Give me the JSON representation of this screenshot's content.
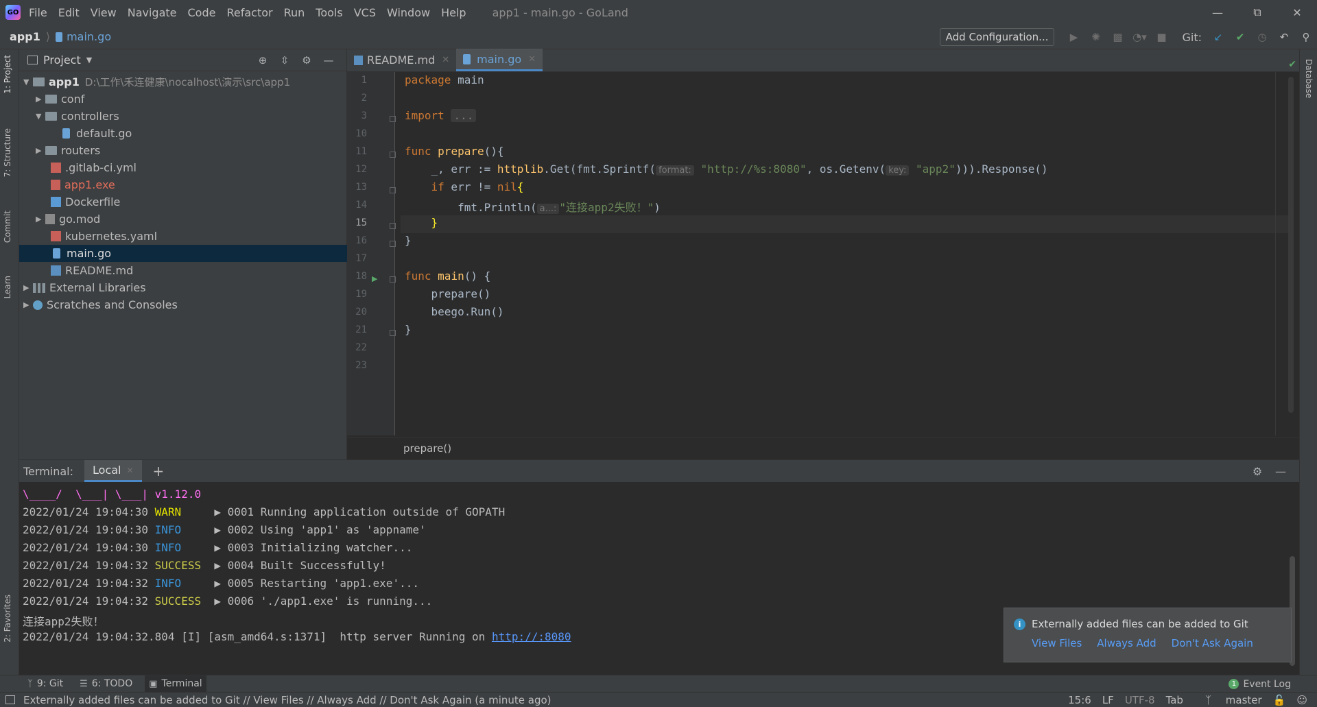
{
  "window": {
    "title": "app1 - main.go - GoLand",
    "menu": [
      "File",
      "Edit",
      "View",
      "Navigate",
      "Code",
      "Refactor",
      "Run",
      "Tools",
      "VCS",
      "Window",
      "Help"
    ],
    "controls": [
      "minimize-icon",
      "restore-icon",
      "close-icon"
    ]
  },
  "navbar": {
    "project": "app1",
    "file": "main.go",
    "add_configuration": "Add Configuration...",
    "git_label": "Git:"
  },
  "left_strip": {
    "project_tab": "1: Project",
    "structure_tab": "7: Structure",
    "commit_tab": "Commit",
    "learn_tab": "Learn",
    "favorites_tab": "2: Favorites"
  },
  "right_strip": {
    "database_tab": "Database"
  },
  "project_panel": {
    "title": "Project",
    "tree": [
      {
        "label": "app1",
        "path": "D:\\工作\\禾连健康\\nocalhost\\演示\\src\\app1"
      },
      {
        "label": "conf"
      },
      {
        "label": "controllers"
      },
      {
        "label": "default.go"
      },
      {
        "label": "routers"
      },
      {
        "label": ".gitlab-ci.yml"
      },
      {
        "label": "app1.exe"
      },
      {
        "label": "Dockerfile"
      },
      {
        "label": "go.mod"
      },
      {
        "label": "kubernetes.yaml"
      },
      {
        "label": "main.go"
      },
      {
        "label": "README.md"
      },
      {
        "label": "External Libraries"
      },
      {
        "label": "Scratches and Consoles"
      }
    ]
  },
  "editor": {
    "tabs": [
      {
        "label": "README.md"
      },
      {
        "label": "main.go"
      }
    ],
    "line_numbers": [
      "1",
      "2",
      "3",
      "10",
      "11",
      "12",
      "13",
      "14",
      "15",
      "16",
      "17",
      "18",
      "19",
      "20",
      "21",
      "22",
      "23"
    ],
    "code": {
      "l1_kw": "package",
      "l1_rest": " main",
      "l3_kw": "import",
      "l3_fold": "...",
      "l11_kw": "func",
      "l11_fn": "prepare",
      "l11_rest": "(){",
      "l12_a": "    _, err := ",
      "l12_fn": "httplib",
      "l12_b": ".Get(fmt.Sprintf(",
      "l12_hint1": "format:",
      "l12_str1": "\"http://%s:8080\"",
      "l12_c": ", os.Getenv(",
      "l12_hint2": "key:",
      "l12_str2": "\"app2\"",
      "l12_d": "))).Response()",
      "l13_a": "    ",
      "l13_kw1": "if",
      "l13_b": " err != ",
      "l13_kw2": "nil",
      "l13_brace": "{",
      "l14_a": "        fmt.Println(",
      "l14_hint": "a...:",
      "l14_str": "\"连接app2失败！\"",
      "l14_b": ")",
      "l15_a": "    ",
      "l15_brace": "}",
      "l16": "}",
      "l18_kw": "func",
      "l18_fn": "main",
      "l18_rest": "() {",
      "l19": "    prepare()",
      "l20": "    beego.Run()",
      "l21": "}"
    },
    "breadcrumb": "prepare()"
  },
  "terminal": {
    "label": "Terminal:",
    "tab": "Local",
    "lines": {
      "banner": "\\____/  \\___| \\___| v1.12.0",
      "l1_ts": "2022/01/24 19:04:30 ",
      "l1_lvl": "WARN",
      "l1_msg": "     ▶ 0001 Running application outside of GOPATH",
      "l2_ts": "2022/01/24 19:04:30 ",
      "l2_lvl": "INFO",
      "l2_msg": "     ▶ 0002 Using 'app1' as 'appname'",
      "l3_ts": "2022/01/24 19:04:30 ",
      "l3_lvl": "INFO",
      "l3_msg": "     ▶ 0003 Initializing watcher...",
      "l4_ts": "2022/01/24 19:04:32 ",
      "l4_lvl": "SUCCESS",
      "l4_msg": "  ▶ 0004 Built Successfully!",
      "l5_ts": "2022/01/24 19:04:32 ",
      "l5_lvl": "INFO",
      "l5_msg": "     ▶ 0005 Restarting 'app1.exe'...",
      "l6_ts": "2022/01/24 19:04:32 ",
      "l6_lvl": "SUCCESS",
      "l6_msg": "  ▶ 0006 './app1.exe' is running...",
      "l7": "连接app2失败！",
      "l8_pre": "2022/01/24 19:04:32.804 [I] [asm_amd64.s:1371]  http server Running on ",
      "l8_link": "http://:8080"
    }
  },
  "notification": {
    "message": "Externally added files can be added to Git",
    "actions": [
      "View Files",
      "Always Add",
      "Don't Ask Again"
    ]
  },
  "tool_windows": {
    "git": "9: Git",
    "todo": "6: TODO",
    "terminal": "Terminal",
    "event_log": "Event Log",
    "event_count": "1"
  },
  "status_bar": {
    "message": "Externally added files can be added to Git // View Files // Always Add // Don't Ask Again (a minute ago)",
    "position": "15:6",
    "line_sep": "LF",
    "encoding": "UTF-8",
    "indent": "Tab",
    "branch": "master"
  },
  "colors": {
    "background": "#2b2b2b",
    "panel": "#3c3f41",
    "keyword": "#cc7832",
    "function": "#ffc66d",
    "string": "#6a8759",
    "selection": "#0d293e",
    "accent": "#4a88c7"
  }
}
